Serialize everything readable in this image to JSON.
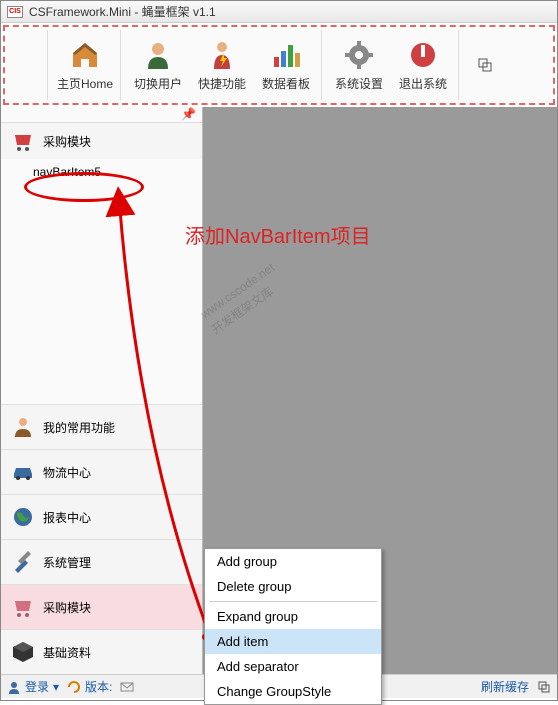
{
  "titlebar": {
    "logo_text": "CIS",
    "title": "CSFramework.Mini - 蝇量框架 v1.1"
  },
  "ribbon": {
    "items": [
      {
        "label": "主页Home",
        "icon": "home"
      },
      {
        "label": "切换用户",
        "icon": "user"
      },
      {
        "label": "快捷功能",
        "icon": "lightning"
      },
      {
        "label": "数据看板",
        "icon": "chart"
      },
      {
        "label": "系统设置",
        "icon": "gear"
      },
      {
        "label": "退出系统",
        "icon": "exit"
      }
    ]
  },
  "sidebar": {
    "active_group": "采购模块",
    "nav_item": "navBarItem5",
    "groups": [
      {
        "label": "我的常用功能",
        "icon": "user-desk"
      },
      {
        "label": "物流中心",
        "icon": "car"
      },
      {
        "label": "报表中心",
        "icon": "globe"
      },
      {
        "label": "系统管理",
        "icon": "tools"
      },
      {
        "label": "采购模块",
        "icon": "cart",
        "active": true
      },
      {
        "label": "基础资料",
        "icon": "cube"
      }
    ]
  },
  "statusbar": {
    "login": "登录",
    "version_label": "版本:",
    "refresh_cache": "刷新缓存"
  },
  "context_menu": {
    "items": [
      "Add group",
      "Delete group",
      "—",
      "Expand group",
      "Add item",
      "Add separator",
      "Change GroupStyle"
    ],
    "highlighted": "Add item"
  },
  "annotation": {
    "text": "添加NavBarItem项目"
  },
  "watermark": {
    "line1": "www.cscode.net",
    "line2": "开发框架文库"
  }
}
